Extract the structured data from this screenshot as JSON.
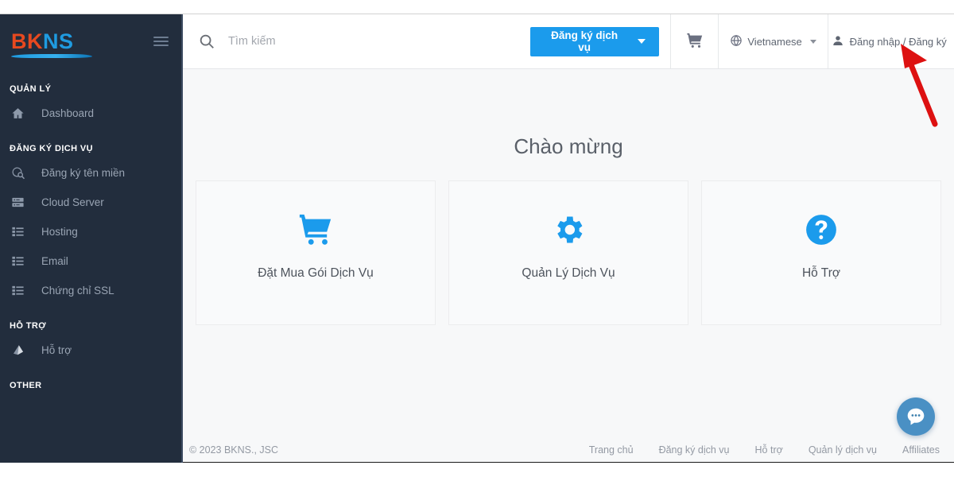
{
  "sidebar": {
    "logo": {
      "part1": "BK",
      "part2": "NS"
    },
    "menu_icon": "hamburger-icon",
    "sections": [
      {
        "label": "QUẢN LÝ",
        "items": [
          {
            "label": "Dashboard",
            "icon": "home-icon"
          }
        ]
      },
      {
        "label": "ĐĂNG KÝ DỊCH VỤ",
        "items": [
          {
            "label": "Đăng ký tên miền",
            "icon": "domain-search-icon"
          },
          {
            "label": "Cloud Server",
            "icon": "server-icon"
          },
          {
            "label": "Hosting",
            "icon": "list-icon"
          },
          {
            "label": "Email",
            "icon": "list-icon"
          },
          {
            "label": "Chứng chỉ SSL",
            "icon": "list-icon"
          }
        ]
      },
      {
        "label": "HỖ TRỢ",
        "items": [
          {
            "label": "Hỗ trợ",
            "icon": "support-icon"
          }
        ]
      },
      {
        "label": "OTHER",
        "items": []
      }
    ]
  },
  "header": {
    "search_placeholder": "Tìm kiếm",
    "search_value": "",
    "register_button": "Đăng ký dịch vụ",
    "cart_icon": "cart-icon",
    "language": "Vietnamese",
    "account": "Đăng nhập / Đăng ký"
  },
  "main": {
    "welcome_title": "Chào mừng",
    "cards": [
      {
        "label": "Đặt Mua Gói Dịch Vụ",
        "icon": "cart-icon"
      },
      {
        "label": "Quản Lý Dịch Vụ",
        "icon": "gear-icon"
      },
      {
        "label": "Hỗ Trợ",
        "icon": "question-circle-icon"
      }
    ]
  },
  "footer": {
    "copyright": "© 2023 BKNS., JSC",
    "links": [
      "Trang chủ",
      "Đăng ký dịch vụ",
      "Hỗ trợ",
      "Quản lý dịch vụ",
      "Affiliates"
    ]
  },
  "chat_widget": {
    "icon": "chat-bubble-icon"
  },
  "colors": {
    "sidebar_bg": "#222d3d",
    "accent_blue": "#1b9bec",
    "logo_orange": "#e8491f",
    "annotation_red": "#dd1111",
    "content_bg": "#f7f8f9"
  }
}
